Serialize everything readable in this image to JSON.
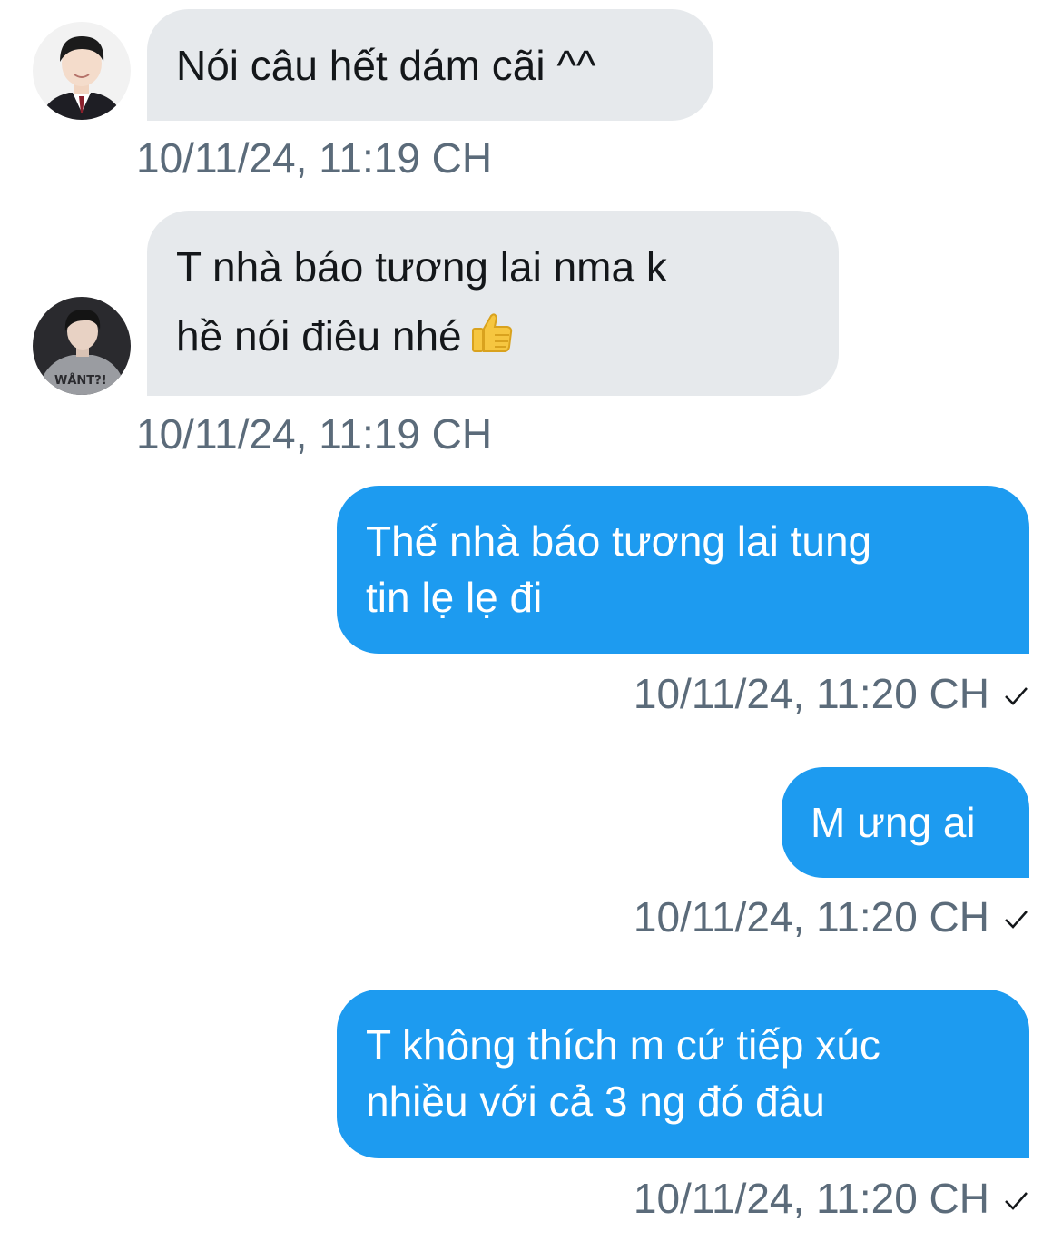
{
  "messages": [
    {
      "direction": "incoming",
      "avatar": "avatar-boy-suit",
      "lines": [
        "Nói câu hết dám cãi ^^"
      ],
      "timestamp": "10/11/24, 11:19 CH"
    },
    {
      "direction": "incoming",
      "avatar": "avatar-boy-hoodie",
      "lines": [
        "T nhà báo tương lai nma k",
        "hề nói điêu nhé"
      ],
      "emoji": "thumbs-up-icon",
      "timestamp": "10/11/24, 11:19 CH"
    },
    {
      "direction": "outgoing",
      "lines": [
        "Thế nhà báo tương lai tung",
        "tin lẹ lẹ đi"
      ],
      "timestamp": "10/11/24, 11:20 CH",
      "status": "sent-check-icon"
    },
    {
      "direction": "outgoing",
      "lines": [
        "M ưng ai"
      ],
      "timestamp": "10/11/24, 11:20 CH",
      "status": "sent-check-icon"
    },
    {
      "direction": "outgoing",
      "lines": [
        "T không thích m cứ tiếp xúc",
        "nhiều với cả 3 ng đó đâu"
      ],
      "timestamp": "10/11/24, 11:20 CH",
      "status": "sent-check-icon"
    }
  ],
  "colors": {
    "incoming_bubble": "#e6e9ec",
    "outgoing_bubble": "#1d9bf0",
    "timestamp": "#5b6b7a"
  }
}
